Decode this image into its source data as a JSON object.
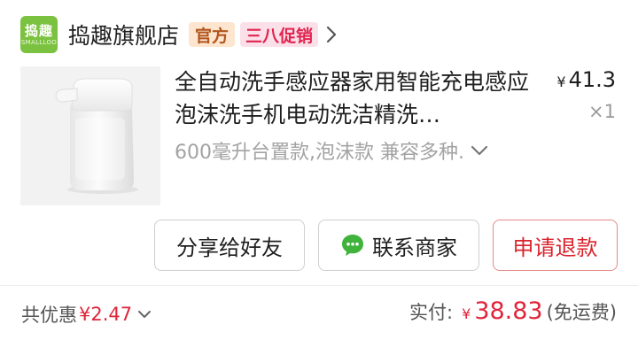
{
  "store": {
    "logo_text": "捣趣",
    "logo_subtext": "SMALLLOO",
    "name": "捣趣旗舰店",
    "badge_official": "官方",
    "badge_promo": "三八促销"
  },
  "product": {
    "title": "全自动洗手感应器家用智能充电感应泡沫洗手机电动洗洁精洗…",
    "price_symbol": "¥",
    "price": "41.3",
    "quantity": "×1",
    "variant": "600毫升台置款,泡沫款 兼容多种."
  },
  "actions": {
    "share_label": "分享给好友",
    "contact_label": "联系商家",
    "refund_label": "申请退款"
  },
  "summary": {
    "discount_label": "共优惠",
    "discount_amount": "¥2.47",
    "total_label": "实付:",
    "total_symbol": "¥",
    "total_amount": "38.83",
    "shipping_note": "(免运费)"
  },
  "colors": {
    "logo_bg": "#7cc241",
    "official_badge_text": "#b1561d",
    "promo_badge_text": "#e0244f",
    "price_red": "#e0243a",
    "chat_green": "#3fb33b"
  },
  "icons": {
    "store_chevron": "chevron-right-icon",
    "variant_chevron": "chevron-down-icon",
    "contact": "chat-bubble-icon",
    "discount_chevron": "chevron-down-icon"
  }
}
